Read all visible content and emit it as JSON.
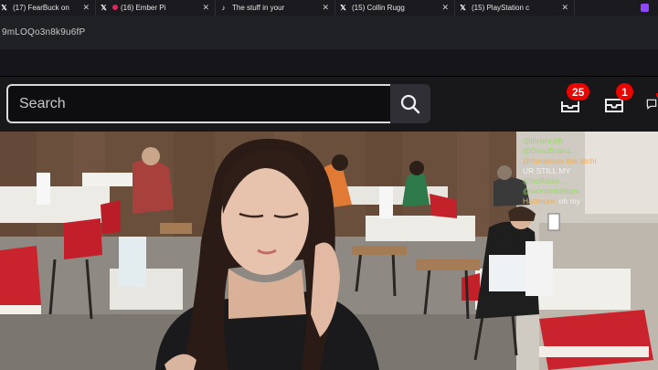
{
  "tabs": [
    {
      "label": "(17) FearBuck on",
      "icon": "x-logo-icon"
    },
    {
      "label": "(16) Ember Pi",
      "icon": "x-logo-icon",
      "live_dot": "#e0245e"
    },
    {
      "label": "The stuff in your",
      "icon": "tiktok-icon"
    },
    {
      "label": "(15) Collin Rugg",
      "icon": "x-logo-icon"
    },
    {
      "label": "(15) PlayStation c",
      "icon": "x-logo-icon"
    }
  ],
  "address_bar": {
    "url": "9mLOQo3n8k9u6fP"
  },
  "header": {
    "search": {
      "placeholder": "Search"
    },
    "prime_badge": "25",
    "inbox_badge": "1",
    "whisper_badge": ""
  },
  "player": {
    "chat": [
      {
        "user": "",
        "text": "@lilvlshrdfh",
        "user_color": "#9bd86a"
      },
      {
        "user": "",
        "text": "@DeadBrainz...",
        "user_color": "#9bd86a"
      },
      {
        "user": "",
        "text": "@minanoss itsk atchi",
        "user_color": "#e9b061"
      },
      {
        "user": "",
        "text": "UR STILL MY",
        "user_color": "#f4f4f4"
      },
      {
        "user": "",
        "text": "@hoRdwo ...",
        "user_color": "#9bd86a"
      },
      {
        "user": "",
        "text": "@worldinbilltops",
        "user_color": "#9bd86a"
      },
      {
        "user": "Hattmore:",
        "text": "oh my",
        "user_color": "#e9b061"
      }
    ]
  },
  "colors": {
    "accent": "#9147ff",
    "badge": "#eb0400",
    "header_bg": "#18181b"
  }
}
